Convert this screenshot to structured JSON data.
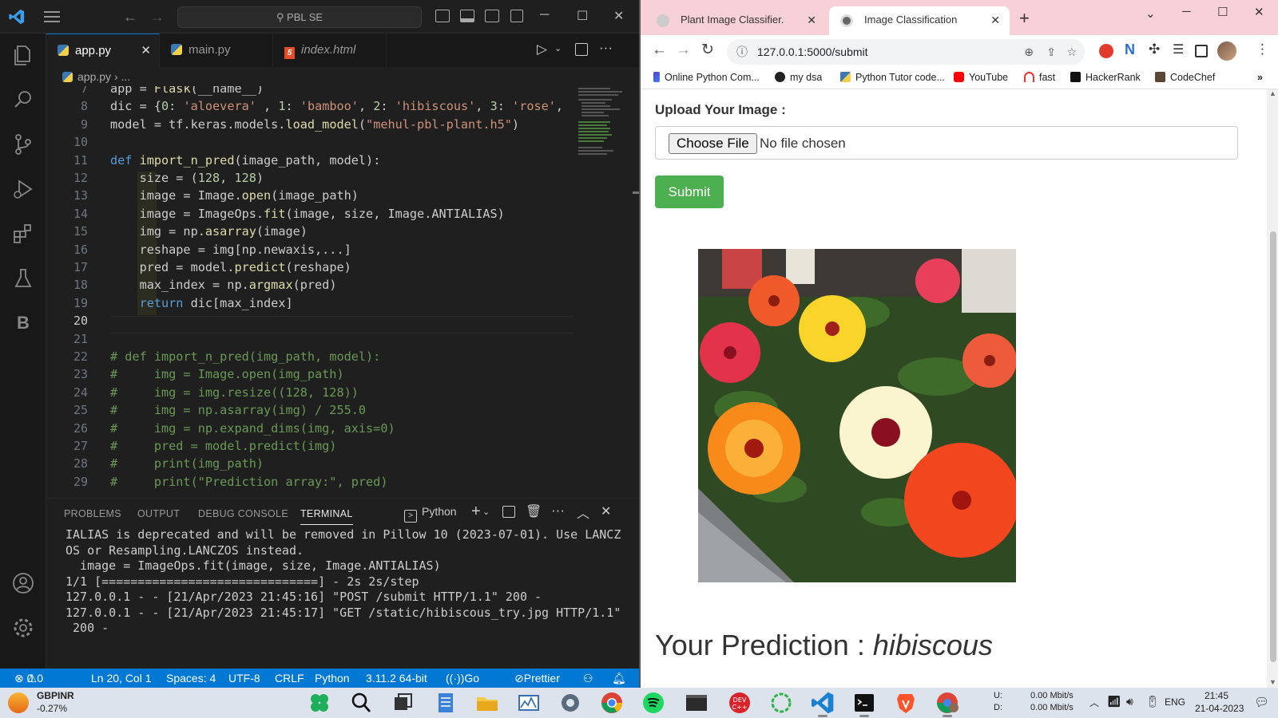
{
  "vscode": {
    "search_placeholder": "PBL SE",
    "tabs": [
      {
        "label": "app.py",
        "active": true
      },
      {
        "label": "main.py",
        "active": false
      },
      {
        "label": "index.html",
        "active": false
      }
    ],
    "breadcrumb": {
      "file": "app.py",
      "rest": "› ..."
    },
    "editor": {
      "lines": [
        {
          "n": "7",
          "code": "app = Flask(__name__)"
        },
        {
          "n": "8",
          "code": "dic = {0: 'aloevera' , 1: 'bamboo', 2: 'hibiscous', 3: 'rose',"
        },
        {
          "n": "9",
          "code": "model = tf.keras.models.load_model(\"mehul-pbl-plant.h5\")"
        },
        {
          "n": "10",
          "code": ""
        },
        {
          "n": "11",
          "code": "def import_n_pred(image_path, model):"
        },
        {
          "n": "12",
          "code": "    size = (128, 128)"
        },
        {
          "n": "13",
          "code": "    image = Image.open(image_path)"
        },
        {
          "n": "14",
          "code": "    image = ImageOps.fit(image, size, Image.ANTIALIAS)"
        },
        {
          "n": "15",
          "code": "    img = np.asarray(image)"
        },
        {
          "n": "16",
          "code": "    reshape = img[np.newaxis,...]"
        },
        {
          "n": "17",
          "code": "    pred = model.predict(reshape)"
        },
        {
          "n": "18",
          "code": "    max_index = np.argmax(pred)"
        },
        {
          "n": "19",
          "code": "    return dic[max_index]"
        },
        {
          "n": "20",
          "code": ""
        },
        {
          "n": "21",
          "code": ""
        },
        {
          "n": "22",
          "code": "# def import_n_pred(img_path, model):"
        },
        {
          "n": "23",
          "code": "#     img = Image.open(img_path)"
        },
        {
          "n": "24",
          "code": "#     img = img.resize((128, 128))"
        },
        {
          "n": "25",
          "code": "#     img = np.asarray(img) / 255.0"
        },
        {
          "n": "26",
          "code": "#     img = np.expand_dims(img, axis=0)"
        },
        {
          "n": "27",
          "code": "#     pred = model.predict(img)"
        },
        {
          "n": "28",
          "code": "#     print(img_path)"
        },
        {
          "n": "29",
          "code": "#     print(\"Prediction array:\", pred)"
        }
      ]
    },
    "panel": {
      "tabs": [
        "PROBLEMS",
        "OUTPUT",
        "DEBUG CONSOLE",
        "TERMINAL"
      ],
      "active_tab": "TERMINAL",
      "shell": "Python",
      "terminal_lines": [
        "IALIAS is deprecated and will be removed in Pillow 10 (2023-07-01). Use LANCZ",
        "OS or Resampling.LANCZOS instead.",
        "  image = ImageOps.fit(image, size, Image.ANTIALIAS)",
        "1/1 [==============================] - 2s 2s/step",
        "127.0.0.1 - - [21/Apr/2023 21:45:16] \"POST /submit HTTP/1.1\" 200 -",
        "127.0.0.1 - - [21/Apr/2023 21:45:17] \"GET /static/hibiscous_try.jpg HTTP/1.1\"",
        " 200 -"
      ]
    },
    "status": {
      "errors": "0",
      "warnings": "0",
      "position": "Ln 20, Col 1",
      "spaces": "Spaces: 4",
      "encoding": "UTF-8",
      "eol": "CRLF",
      "language": "Python",
      "interpreter": "3.11.2 64-bit",
      "golive": "Go Live",
      "prettier": "Prettier"
    }
  },
  "browser": {
    "tabs": [
      {
        "label": "Plant Image Classifier.",
        "active": false
      },
      {
        "label": "Image Classification",
        "active": true
      }
    ],
    "url": "127.0.0.1:5000/submit",
    "bookmarks": [
      "Online Python Com...",
      "my dsa",
      "Python Tutor code...",
      "YouTube",
      "fast",
      "HackerRank",
      "CodeChef"
    ],
    "page": {
      "upload_label": "Upload Your Image :",
      "choose_file": "Choose File",
      "no_file": "No file chosen",
      "submit": "Submit",
      "prediction_prefix": "Your Prediction : ",
      "prediction_value": "hibiscous"
    }
  },
  "taskbar": {
    "ticker": "GBPINR",
    "change": "-0.27%",
    "net_up_label": "U:",
    "net_down_label": "D:",
    "net_up": "0.00 Mbit/s",
    "net_down": "0.00 Mbit/s",
    "lang": "ENG",
    "time": "21:45",
    "date": "21-04-2023"
  }
}
